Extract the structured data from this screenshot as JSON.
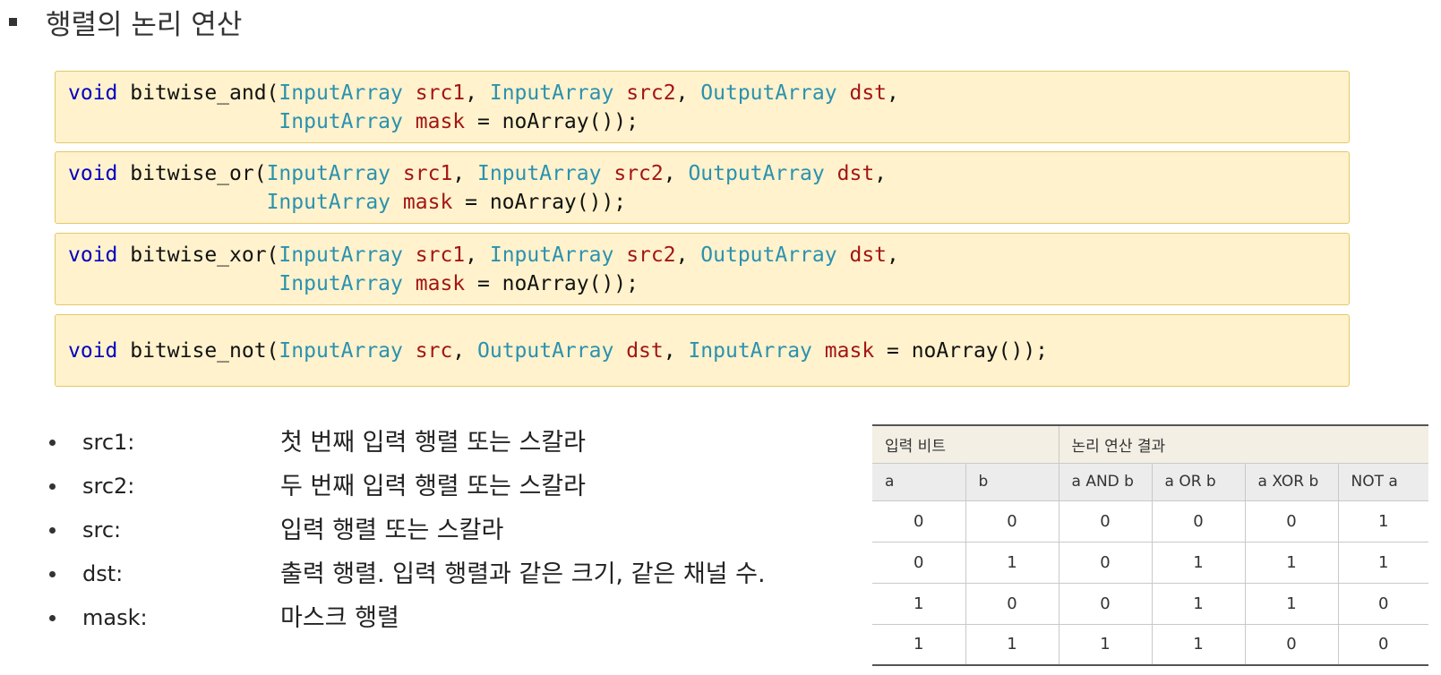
{
  "title": "행렬의 논리 연산",
  "code_blocks": [
    {
      "line1": [
        {
          "t": "void",
          "c": "kw"
        },
        {
          "t": " bitwise_and(",
          "c": "tx"
        },
        {
          "t": "InputArray",
          "c": "ty"
        },
        {
          "t": " ",
          "c": "tx"
        },
        {
          "t": "src1",
          "c": "pm"
        },
        {
          "t": ", ",
          "c": "tx"
        },
        {
          "t": "InputArray",
          "c": "ty"
        },
        {
          "t": " ",
          "c": "tx"
        },
        {
          "t": "src2",
          "c": "pm"
        },
        {
          "t": ", ",
          "c": "tx"
        },
        {
          "t": "OutputArray",
          "c": "ty"
        },
        {
          "t": " ",
          "c": "tx"
        },
        {
          "t": "dst",
          "c": "pm"
        },
        {
          "t": ",",
          "c": "tx"
        }
      ],
      "line2": [
        {
          "t": "                 ",
          "c": "tx"
        },
        {
          "t": "InputArray",
          "c": "ty"
        },
        {
          "t": " ",
          "c": "tx"
        },
        {
          "t": "mask",
          "c": "pm"
        },
        {
          "t": " = noArray());",
          "c": "tx"
        }
      ]
    },
    {
      "line1": [
        {
          "t": "void",
          "c": "kw"
        },
        {
          "t": " bitwise_or(",
          "c": "tx"
        },
        {
          "t": "InputArray",
          "c": "ty"
        },
        {
          "t": " ",
          "c": "tx"
        },
        {
          "t": "src1",
          "c": "pm"
        },
        {
          "t": ", ",
          "c": "tx"
        },
        {
          "t": "InputArray",
          "c": "ty"
        },
        {
          "t": " ",
          "c": "tx"
        },
        {
          "t": "src2",
          "c": "pm"
        },
        {
          "t": ", ",
          "c": "tx"
        },
        {
          "t": "OutputArray",
          "c": "ty"
        },
        {
          "t": " ",
          "c": "tx"
        },
        {
          "t": "dst",
          "c": "pm"
        },
        {
          "t": ",",
          "c": "tx"
        }
      ],
      "line2": [
        {
          "t": "                ",
          "c": "tx"
        },
        {
          "t": "InputArray",
          "c": "ty"
        },
        {
          "t": " ",
          "c": "tx"
        },
        {
          "t": "mask",
          "c": "pm"
        },
        {
          "t": " = noArray());",
          "c": "tx"
        }
      ]
    },
    {
      "line1": [
        {
          "t": "void",
          "c": "kw"
        },
        {
          "t": " bitwise_xor(",
          "c": "tx"
        },
        {
          "t": "InputArray",
          "c": "ty"
        },
        {
          "t": " ",
          "c": "tx"
        },
        {
          "t": "src1",
          "c": "pm"
        },
        {
          "t": ", ",
          "c": "tx"
        },
        {
          "t": "InputArray",
          "c": "ty"
        },
        {
          "t": " ",
          "c": "tx"
        },
        {
          "t": "src2",
          "c": "pm"
        },
        {
          "t": ", ",
          "c": "tx"
        },
        {
          "t": "OutputArray",
          "c": "ty"
        },
        {
          "t": " ",
          "c": "tx"
        },
        {
          "t": "dst",
          "c": "pm"
        },
        {
          "t": ",",
          "c": "tx"
        }
      ],
      "line2": [
        {
          "t": "                 ",
          "c": "tx"
        },
        {
          "t": "InputArray",
          "c": "ty"
        },
        {
          "t": " ",
          "c": "tx"
        },
        {
          "t": "mask",
          "c": "pm"
        },
        {
          "t": " = noArray());",
          "c": "tx"
        }
      ]
    },
    {
      "line1": [
        {
          "t": "void",
          "c": "kw"
        },
        {
          "t": " bitwise_not(",
          "c": "tx"
        },
        {
          "t": "InputArray",
          "c": "ty"
        },
        {
          "t": " ",
          "c": "tx"
        },
        {
          "t": "src",
          "c": "pm"
        },
        {
          "t": ", ",
          "c": "tx"
        },
        {
          "t": "OutputArray",
          "c": "ty"
        },
        {
          "t": " ",
          "c": "tx"
        },
        {
          "t": "dst",
          "c": "pm"
        },
        {
          "t": ", ",
          "c": "tx"
        },
        {
          "t": "InputArray",
          "c": "ty"
        },
        {
          "t": " ",
          "c": "tx"
        },
        {
          "t": "mask",
          "c": "pm"
        },
        {
          "t": " = noArray());",
          "c": "tx"
        }
      ],
      "line2": []
    }
  ],
  "params": [
    {
      "name": "src1:",
      "desc": "첫 번째 입력 행렬 또는 스칼라"
    },
    {
      "name": "src2:",
      "desc": "두 번째 입력 행렬 또는 스칼라"
    },
    {
      "name": "src:",
      "desc": "입력 행렬 또는 스칼라"
    },
    {
      "name": "dst:",
      "desc": "출력 행렬. 입력 행렬과 같은 크기, 같은 채널 수."
    },
    {
      "name": "mask:",
      "desc": "마스크 행렬"
    }
  ],
  "truth_table": {
    "group_headers": [
      "입력 비트",
      "논리 연산 결과"
    ],
    "columns": [
      "a",
      "b",
      "a AND b",
      "a OR b",
      "a XOR b",
      "NOT a"
    ],
    "rows": [
      [
        "0",
        "0",
        "0",
        "0",
        "0",
        "1"
      ],
      [
        "0",
        "1",
        "0",
        "1",
        "1",
        "1"
      ],
      [
        "1",
        "0",
        "0",
        "1",
        "1",
        "0"
      ],
      [
        "1",
        "1",
        "1",
        "1",
        "0",
        "0"
      ]
    ]
  },
  "colors": {
    "keyword": "#0000c0",
    "type": "#2b91af",
    "param": "#a31515",
    "code_background": "#fff2cc"
  }
}
